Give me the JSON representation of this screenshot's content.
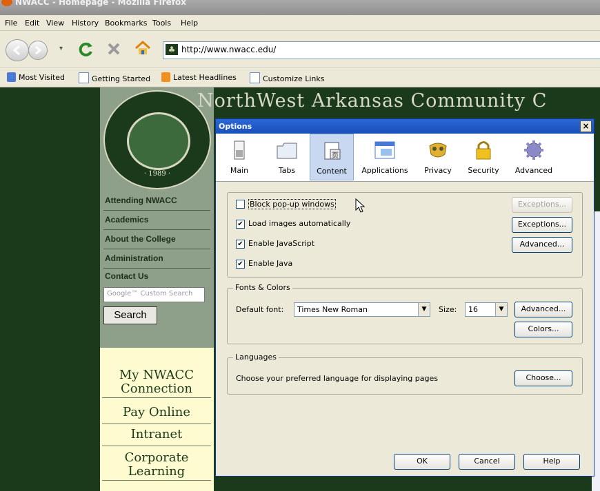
{
  "window": {
    "title": "NWACC - Homepage - Mozilla Firefox"
  },
  "menu": [
    "File",
    "Edit",
    "View",
    "History",
    "Bookmarks",
    "Tools",
    "Help"
  ],
  "url": "http://www.nwacc.edu/",
  "bookmarks": [
    "Most Visited",
    "Getting Started",
    "Latest Headlines",
    "Customize Links"
  ],
  "site": {
    "banner": "NorthWest Arkansas Community C",
    "seal_year": "· 1989 ·",
    "nav": [
      "Attending NWACC",
      "Academics",
      "About the College",
      "Administration",
      "Contact Us"
    ],
    "search_placeholder": "Google™ Custom Search",
    "search_button": "Search",
    "quick_links": [
      "My NWACC Connection",
      "Pay Online",
      "Intranet",
      "Corporate Learning"
    ]
  },
  "dialog": {
    "title": "Options",
    "close": "×",
    "panes": [
      "Main",
      "Tabs",
      "Content",
      "Applications",
      "Privacy",
      "Security",
      "Advanced"
    ],
    "selected_pane": "Content",
    "checkboxes": [
      {
        "label": "Block pop-up windows",
        "checked": false
      },
      {
        "label": "Load images automatically",
        "checked": true
      },
      {
        "label": "Enable JavaScript",
        "checked": true
      },
      {
        "label": "Enable Java",
        "checked": true
      }
    ],
    "side_buttons": [
      "Exceptions...",
      "Exceptions...",
      "Advanced..."
    ],
    "fonts": {
      "group_label": "Fonts & Colors",
      "default_font_label": "Default font:",
      "default_font": "Times New Roman",
      "size_label": "Size:",
      "size": "16",
      "advanced": "Advanced...",
      "colors": "Colors..."
    },
    "languages": {
      "group_label": "Languages",
      "text": "Choose your preferred language for displaying pages",
      "choose": "Choose..."
    },
    "footer": {
      "ok": "OK",
      "cancel": "Cancel",
      "help": "Help"
    }
  }
}
